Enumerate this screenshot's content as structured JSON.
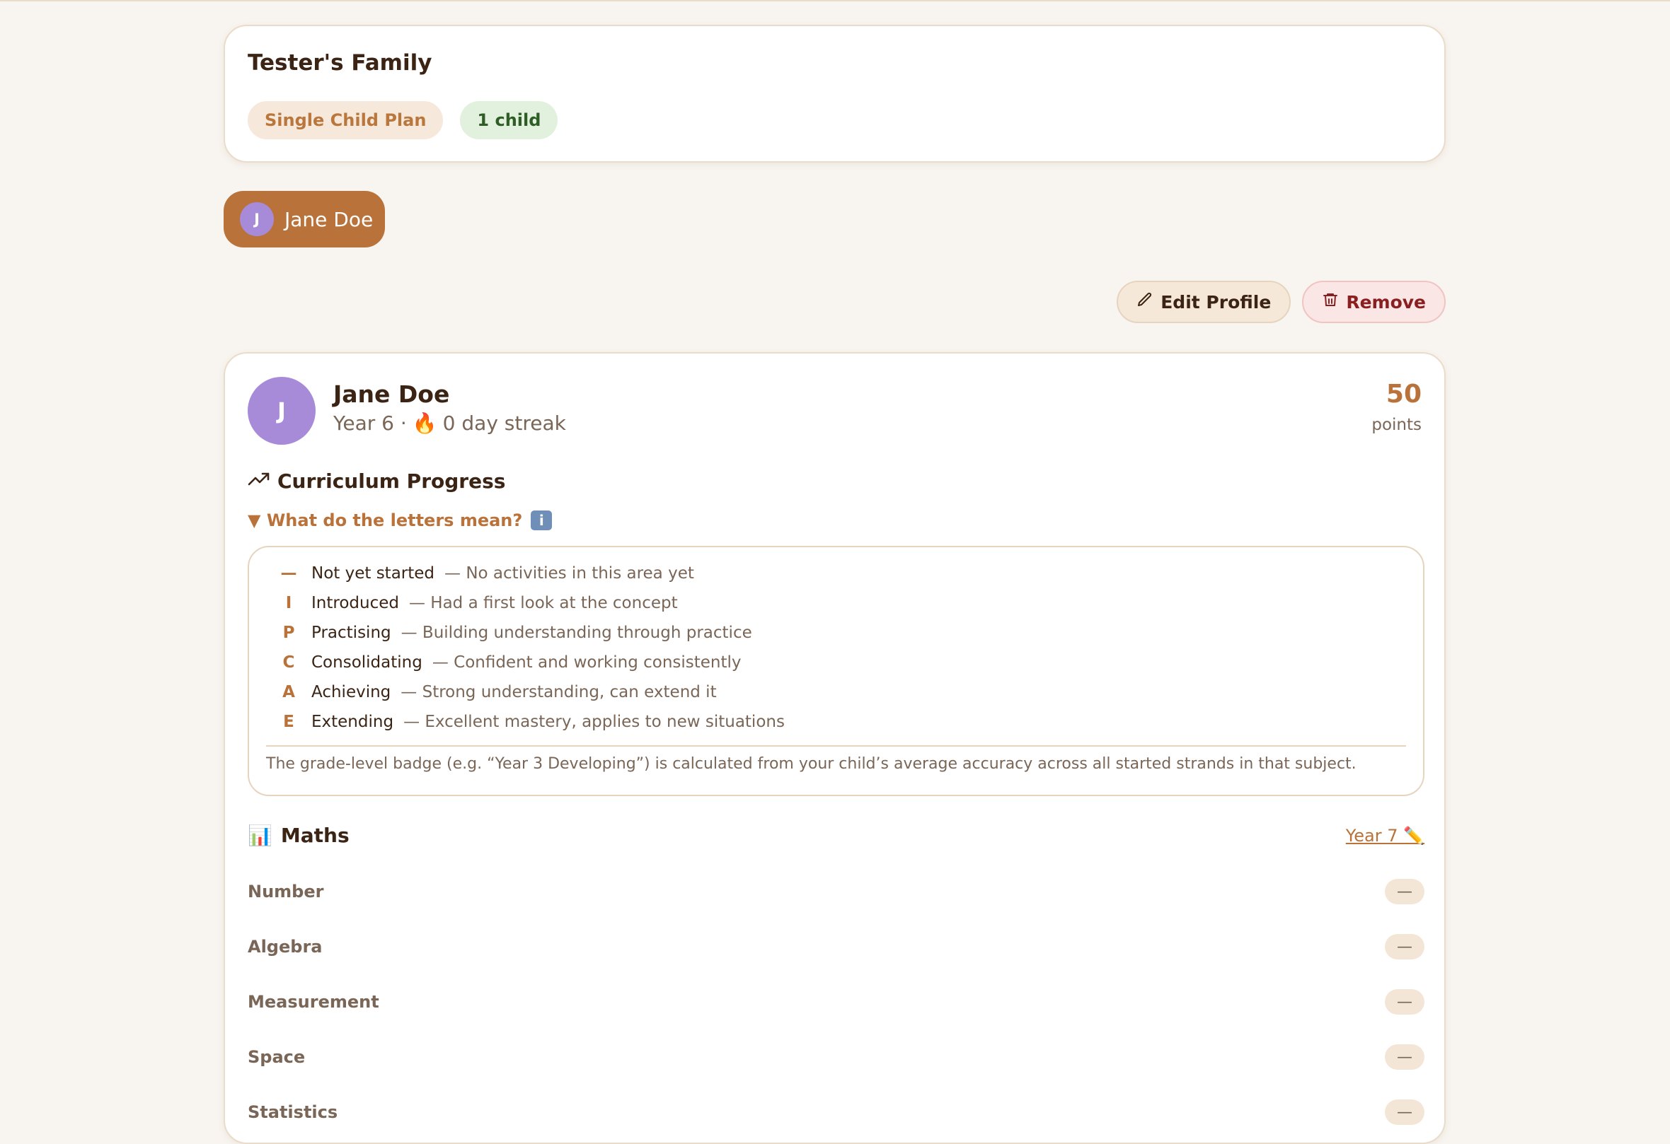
{
  "family": {
    "title": "Tester's Family",
    "plan_label": "Single Child Plan",
    "children_count_label": "1 child"
  },
  "child_tab": {
    "initial": "J",
    "name": "Jane Doe"
  },
  "actions": {
    "edit_label": "Edit Profile",
    "remove_label": "Remove"
  },
  "profile": {
    "initial": "J",
    "name": "Jane Doe",
    "year": "Year 6 ·",
    "streak_emoji": "🔥",
    "streak": "0 day streak",
    "points_value": "50",
    "points_label": "points"
  },
  "curriculum": {
    "title": "Curriculum Progress",
    "legend_toggle": "▼ What do the letters mean?",
    "legend": [
      {
        "letter": "—",
        "name": "Not yet started",
        "desc": "— No activities in this area yet"
      },
      {
        "letter": "I",
        "name": "Introduced",
        "desc": "— Had a first look at the concept"
      },
      {
        "letter": "P",
        "name": "Practising",
        "desc": "— Building understanding through practice"
      },
      {
        "letter": "C",
        "name": "Consolidating",
        "desc": "— Confident and working consistently"
      },
      {
        "letter": "A",
        "name": "Achieving",
        "desc": "— Strong understanding, can extend it"
      },
      {
        "letter": "E",
        "name": "Extending",
        "desc": "— Excellent mastery, applies to new situations"
      }
    ],
    "legend_note": "The grade-level badge (e.g. “Year 3 Developing”) is calculated from your child’s average accuracy across all started strands in that subject."
  },
  "subject": {
    "emoji": "📊",
    "title": "Maths",
    "year_label": "Year 7 ✏️",
    "strands": [
      {
        "name": "Number",
        "status": "—"
      },
      {
        "name": "Algebra",
        "status": "—"
      },
      {
        "name": "Measurement",
        "status": "—"
      },
      {
        "name": "Space",
        "status": "—"
      },
      {
        "name": "Statistics",
        "status": "—"
      }
    ]
  },
  "colors": {
    "accent": "#b9733a",
    "background": "#f8f4ef",
    "avatar": "#a78bd8",
    "remove": "#8a1f22"
  }
}
